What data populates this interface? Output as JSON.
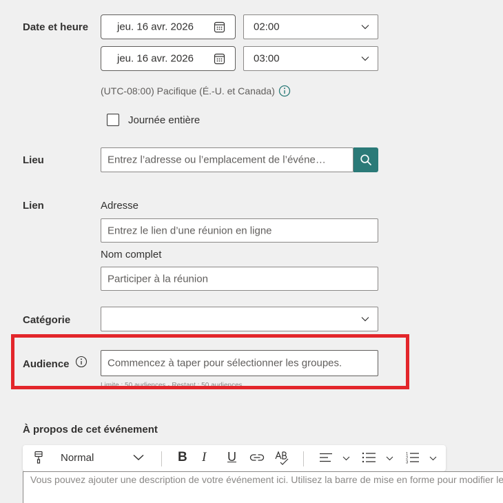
{
  "date_time": {
    "label": "Date et heure",
    "start_date": "jeu. 16 avr. 2026",
    "start_time": "02:00",
    "end_date": "jeu. 16 avr. 2026",
    "end_time": "03:00",
    "timezone": "(UTC-08:00) Pacifique (É.-U. et Canada)",
    "all_day_label": "Journée entière"
  },
  "location": {
    "label": "Lieu",
    "placeholder": "Entrez l’adresse ou l’emplacement de l’événe…"
  },
  "link": {
    "label": "Lien",
    "address_label": "Adresse",
    "address_placeholder": "Entrez le lien d’une réunion en ligne",
    "name_label": "Nom complet",
    "name_placeholder": "Participer à la réunion"
  },
  "category": {
    "label": "Catégorie",
    "value": ""
  },
  "audience": {
    "label": "Audience",
    "placeholder": "Commencez à taper pour sélectionner les groupes.",
    "hint": "Limite : 50 audiences · Restant : 50 audiences"
  },
  "about": {
    "label": "À propos de cet événement",
    "style_value": "Normal",
    "description_placeholder": "Vous pouvez ajouter une description de votre événement ici. Utilisez la barre de mise en forme pour modifier le texte."
  },
  "colors": {
    "accent": "#2b7a78",
    "highlight": "#e3262b"
  },
  "icons": [
    "calendar-icon",
    "chevron-down-icon",
    "info-icon",
    "search-icon",
    "format-painter-icon",
    "bold-icon",
    "italic-icon",
    "underline-icon",
    "link-icon",
    "spellcheck-icon",
    "align-icon",
    "bullet-list-icon",
    "numbered-list-icon"
  ]
}
